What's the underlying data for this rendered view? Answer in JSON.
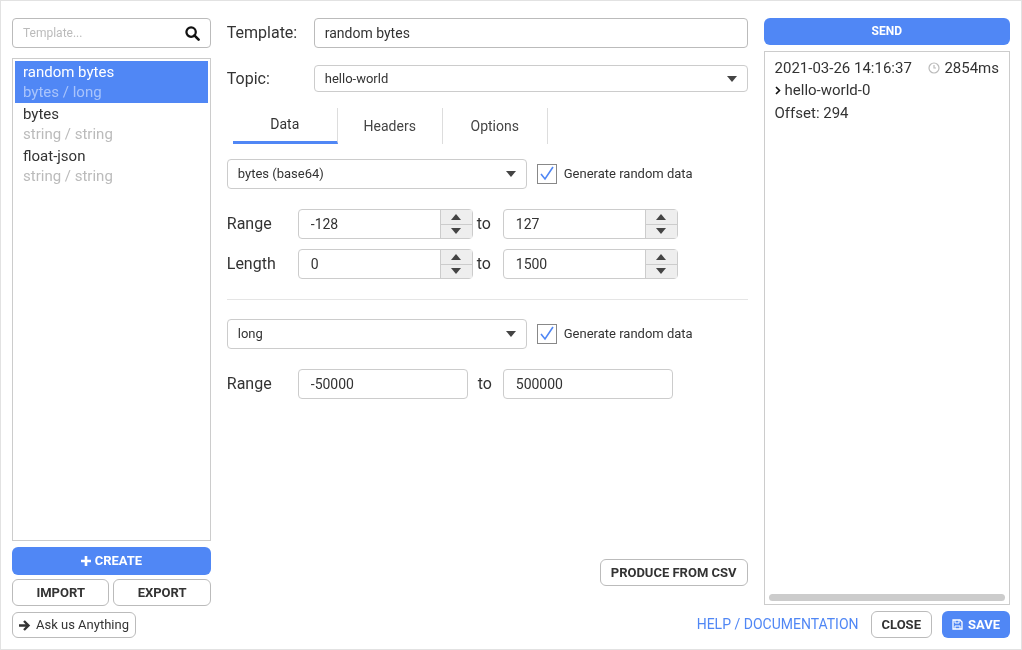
{
  "sidebar": {
    "search": {
      "placeholder": "Template..."
    },
    "items": [
      {
        "name": "random bytes",
        "subtitle": "bytes / long",
        "selected": true
      },
      {
        "name": "bytes",
        "subtitle": "string / string",
        "selected": false
      },
      {
        "name": "float-json",
        "subtitle": "string / string",
        "selected": false
      }
    ],
    "create": "CREATE",
    "import": "IMPORT",
    "export": "EXPORT",
    "ask": "Ask us Anything"
  },
  "editor": {
    "template_label": "Template:",
    "template_value": "random bytes",
    "topic_label": "Topic:",
    "topic_value": "hello-world",
    "tabs": [
      {
        "label": "Data",
        "selected": true
      },
      {
        "label": "Headers",
        "selected": false
      },
      {
        "label": "Options",
        "selected": false
      }
    ],
    "sections": [
      {
        "type": "bytes (base64)",
        "generate_label": "Generate random data",
        "generate": true,
        "rows": [
          {
            "kind": "spinner",
            "label": "Range",
            "from": "-128",
            "sep": "to",
            "to": "127"
          },
          {
            "kind": "spinner",
            "label": "Length",
            "from": "0",
            "sep": "to",
            "to": "1500"
          }
        ]
      },
      {
        "type": "long",
        "generate_label": "Generate random data",
        "generate": true,
        "rows": [
          {
            "kind": "plain",
            "label": "Range",
            "from": "-50000",
            "sep": "to",
            "to": "500000"
          }
        ]
      }
    ],
    "produce_csv": "PRODUCE FROM CSV"
  },
  "result": {
    "send": "SEND",
    "timestamp": "2021-03-26 14:16:37",
    "duration": "2854ms",
    "partition": "hello-world-0",
    "offset": "Offset: 294"
  },
  "footer": {
    "help": "HELP / DOCUMENTATION",
    "close": "CLOSE",
    "save": "SAVE"
  }
}
